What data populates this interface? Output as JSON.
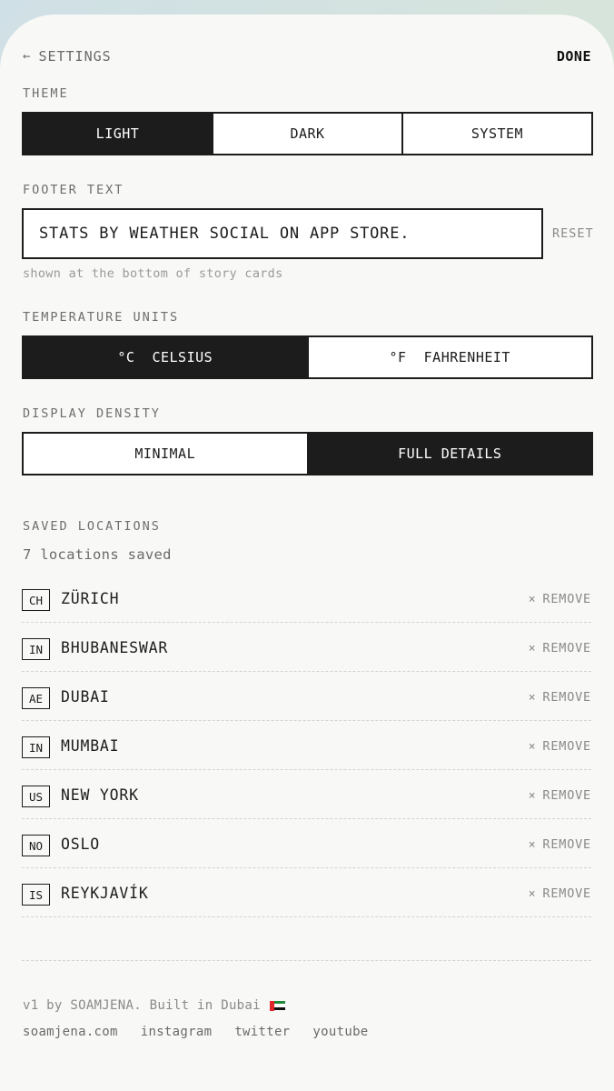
{
  "header": {
    "back_label": "SETTINGS",
    "done_label": "DONE"
  },
  "theme": {
    "label": "THEME",
    "options": [
      "LIGHT",
      "DARK",
      "SYSTEM"
    ],
    "selected": "LIGHT"
  },
  "footer_text": {
    "label": "FOOTER TEXT",
    "value": "STATS BY WEATHER SOCIAL ON APP STORE.",
    "reset_label": "RESET",
    "hint": "shown at the bottom of story cards"
  },
  "temperature_units": {
    "label": "TEMPERATURE UNITS",
    "options": [
      "°C  CELSIUS",
      "°F  FAHRENHEIT"
    ],
    "selected": "°C  CELSIUS"
  },
  "display_density": {
    "label": "DISPLAY DENSITY",
    "options": [
      "MINIMAL",
      "FULL DETAILS"
    ],
    "selected": "FULL DETAILS"
  },
  "saved_locations": {
    "label": "SAVED LOCATIONS",
    "count_text": "7 locations saved",
    "remove_label": "REMOVE",
    "items": [
      {
        "code": "CH",
        "name": "ZÜRICH"
      },
      {
        "code": "IN",
        "name": "BHUBANESWAR"
      },
      {
        "code": "AE",
        "name": "DUBAI"
      },
      {
        "code": "IN",
        "name": "MUMBAI"
      },
      {
        "code": "US",
        "name": "NEW YORK"
      },
      {
        "code": "NO",
        "name": "OSLO"
      },
      {
        "code": "IS",
        "name": "REYKJAVÍK"
      }
    ]
  },
  "footer": {
    "credit": "v1 by SOAMJENA. Built in Dubai",
    "links": [
      "soamjena.com",
      "instagram",
      "twitter",
      "youtube"
    ]
  },
  "colors": {
    "accent": "#1c1c1c",
    "background": "#f8f8f6",
    "muted": "#8a8a8a"
  },
  "icons": {
    "back": "arrow-left-icon",
    "remove": "close-icon",
    "flag": "uae-flag-icon"
  }
}
